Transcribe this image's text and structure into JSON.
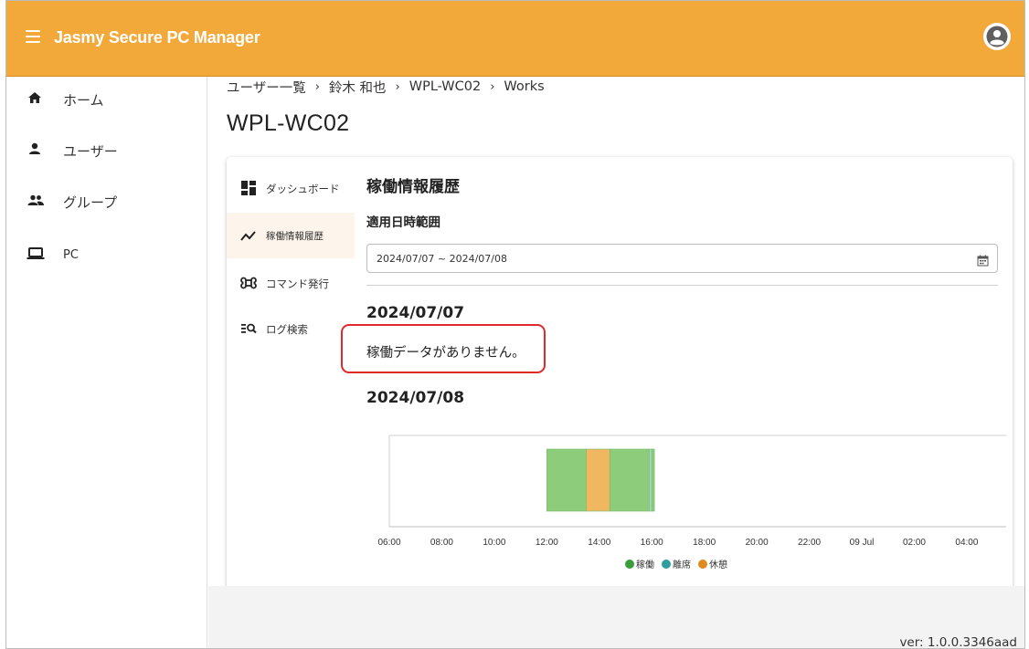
{
  "app": {
    "title": "Jasmy Secure PC Manager",
    "accent_color": "#f3a93a",
    "menu_icon": "menu-icon",
    "account_icon": "account-circle-icon"
  },
  "sidebar": {
    "items": [
      {
        "label": "ホーム",
        "icon": "home-icon"
      },
      {
        "label": "ユーザー",
        "icon": "person-icon"
      },
      {
        "label": "グループ",
        "icon": "group-icon"
      },
      {
        "label": "PC",
        "icon": "laptop-icon"
      }
    ]
  },
  "breadcrumb": {
    "items": [
      "ユーザー一覧",
      "鈴木 和也",
      "WPL-WC02",
      "Works"
    ],
    "separator": "›"
  },
  "page": {
    "title": "WPL-WC02"
  },
  "card_nav": {
    "items": [
      {
        "label": "ダッシュボード",
        "icon": "dashboard-icon",
        "active": false
      },
      {
        "label": "稼働情報履歴",
        "icon": "trending-icon",
        "active": true
      },
      {
        "label": "コマンド発行",
        "icon": "command-icon",
        "active": false
      },
      {
        "label": "ログ検索",
        "icon": "log-search-icon",
        "active": false
      }
    ]
  },
  "content": {
    "section_title": "稼働情報履歴",
    "range_label": "適用日時範囲",
    "date_range_value": "2024/07/07 ~ 2024/07/08",
    "calendar_icon": "calendar-icon",
    "days": [
      {
        "date": "2024/07/07",
        "message": "稼働データがありません。"
      },
      {
        "date": "2024/07/08"
      }
    ]
  },
  "chart_data": {
    "type": "bar",
    "orientation": "horizontal-timeline",
    "x_ticks": [
      "06:00",
      "08:00",
      "10:00",
      "12:00",
      "14:00",
      "16:00",
      "18:00",
      "20:00",
      "22:00",
      "09 Jul",
      "02:00",
      "04:00"
    ],
    "x_range_hours": [
      6,
      29.5
    ],
    "segments": [
      {
        "status": "稼働",
        "start_hour": 12.0,
        "end_hour": 13.5
      },
      {
        "status": "休憩",
        "start_hour": 13.5,
        "end_hour": 14.4
      },
      {
        "status": "稼働",
        "start_hour": 14.4,
        "end_hour": 15.9
      },
      {
        "status": "離席",
        "start_hour": 15.9,
        "end_hour": 16.0
      },
      {
        "status": "稼働",
        "start_hour": 16.0,
        "end_hour": 16.1
      }
    ],
    "legend": [
      {
        "name": "稼働",
        "color": "#3b9c3b"
      },
      {
        "name": "離席",
        "color": "#2e9e9e"
      },
      {
        "name": "休憩",
        "color": "#e08a1e"
      }
    ],
    "segment_colors": {
      "稼働": "#8ccc7a",
      "離席": "#9fd6c8",
      "休憩": "#f0b760"
    },
    "legend_placement": "bottom"
  },
  "footer": {
    "version": "ver: 1.0.0.3346aad"
  }
}
